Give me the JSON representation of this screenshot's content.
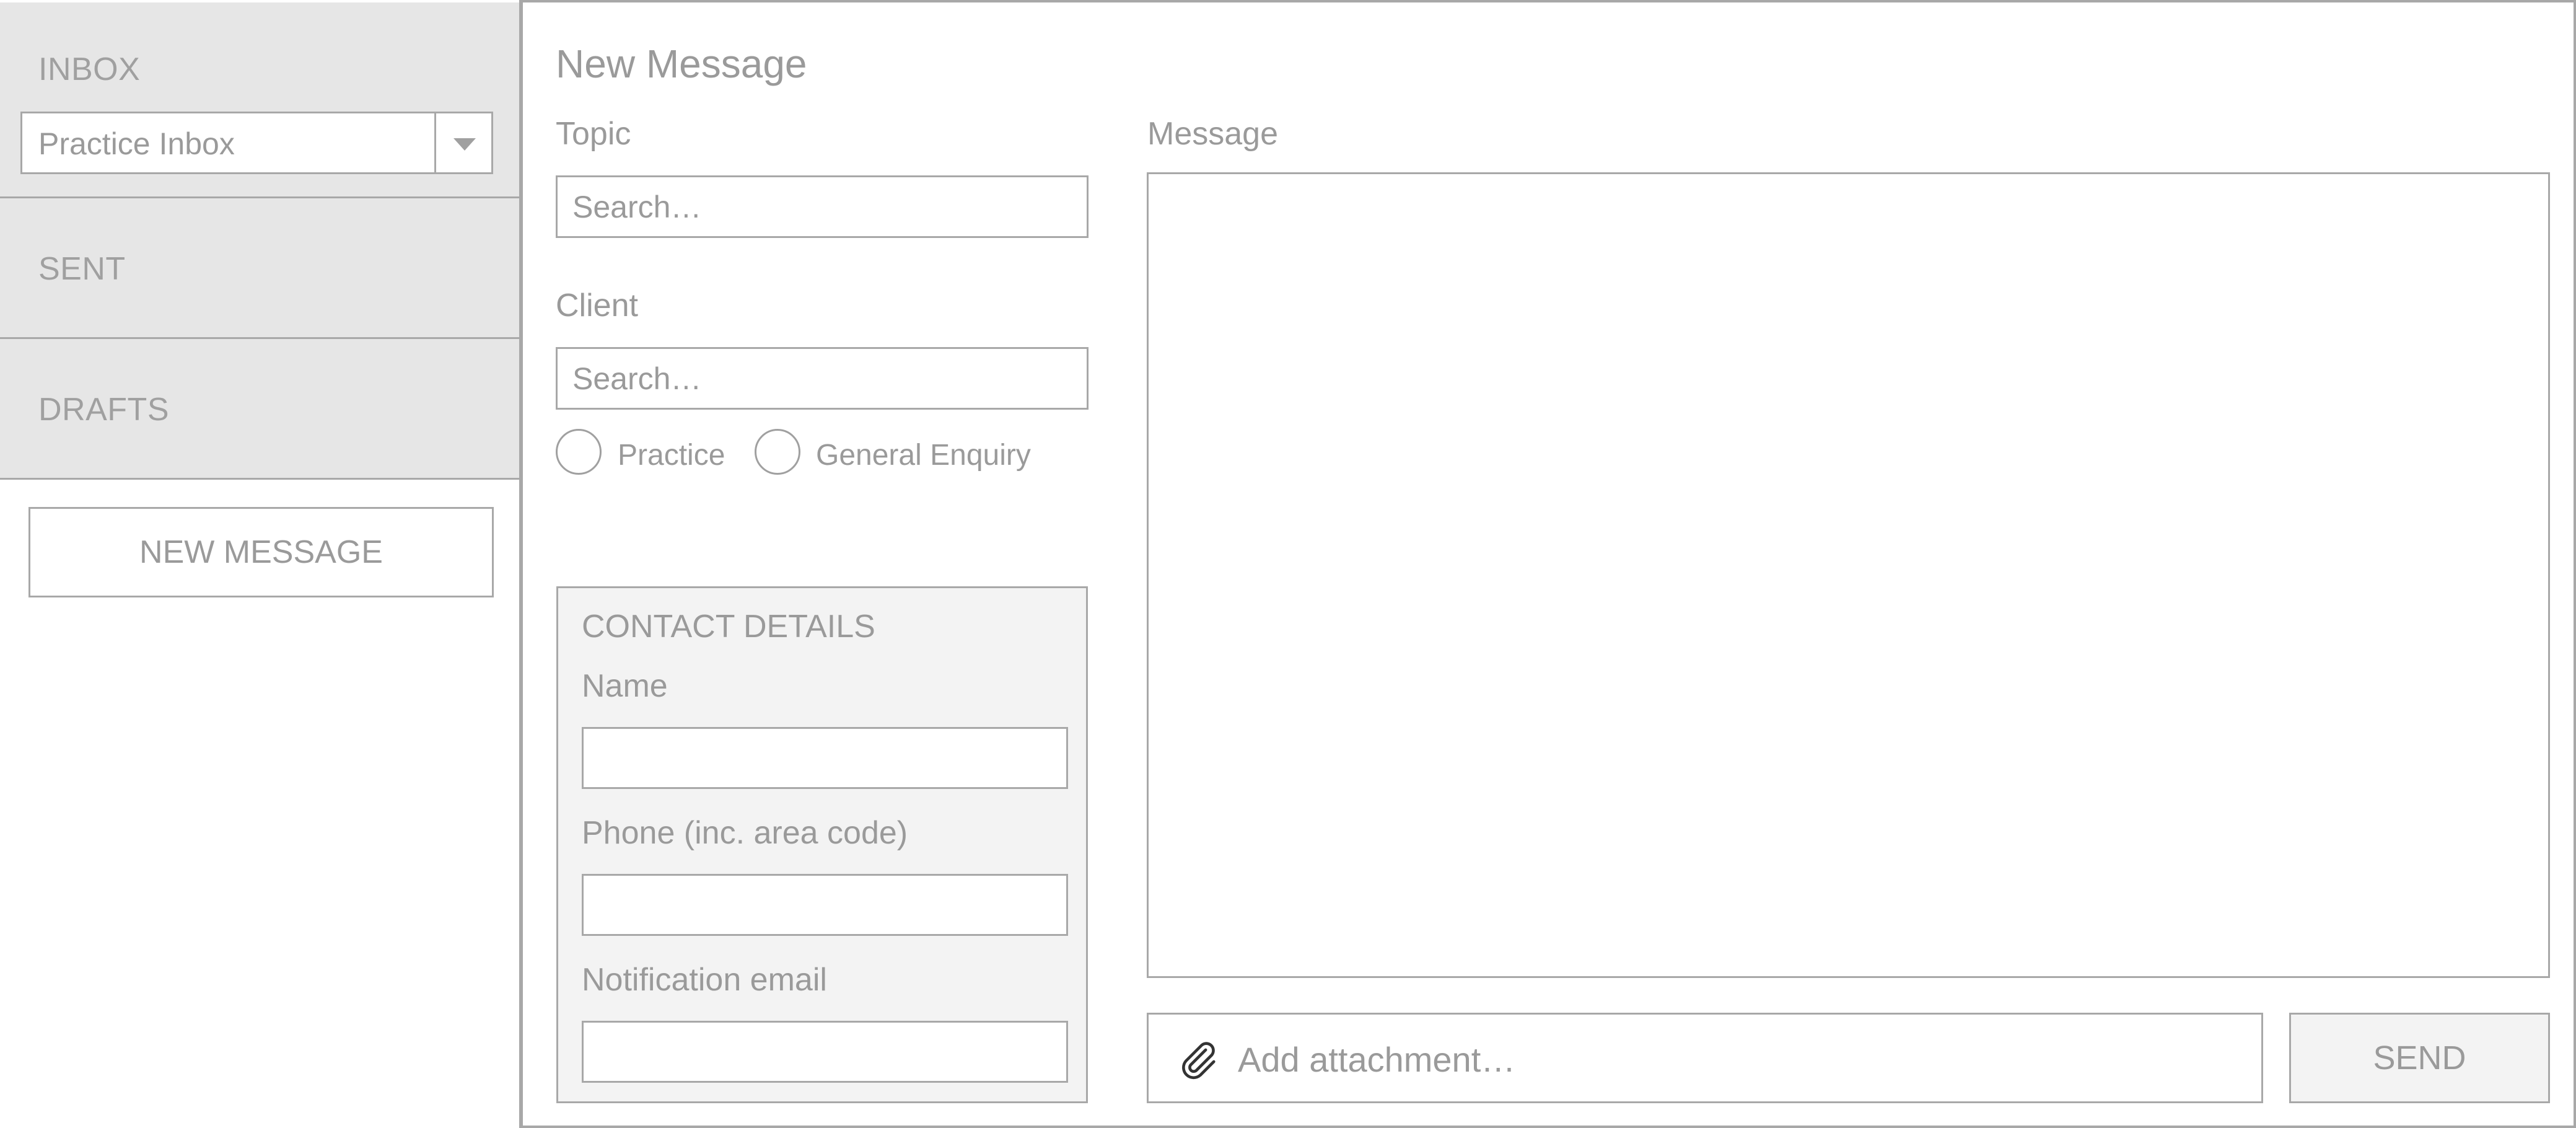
{
  "sidebar": {
    "inbox_label": "INBOX",
    "inbox_select_value": "Practice Inbox",
    "sent_label": "SENT",
    "drafts_label": "DRAFTS",
    "new_message_label": "NEW MESSAGE"
  },
  "main": {
    "title": "New Message",
    "topic_label": "Topic",
    "topic_placeholder": "Search…",
    "client_label": "Client",
    "client_placeholder": "Search…",
    "radio_options": [
      "Practice",
      "General Enquiry"
    ],
    "contact": {
      "title": "CONTACT DETAILS",
      "name_label": "Name",
      "phone_label": "Phone (inc. area code)",
      "email_label": "Notification email"
    },
    "message_label": "Message",
    "attachment_text": "Add attachment…",
    "send_label": "SEND"
  },
  "icons": {
    "dropdown": "caret-down-icon",
    "attachment": "paperclip-icon"
  },
  "colors": {
    "border": "#a8a8a8",
    "text": "#9a9a9a",
    "panel": "#e6e6e6",
    "contact_panel": "#f3f3f3"
  }
}
